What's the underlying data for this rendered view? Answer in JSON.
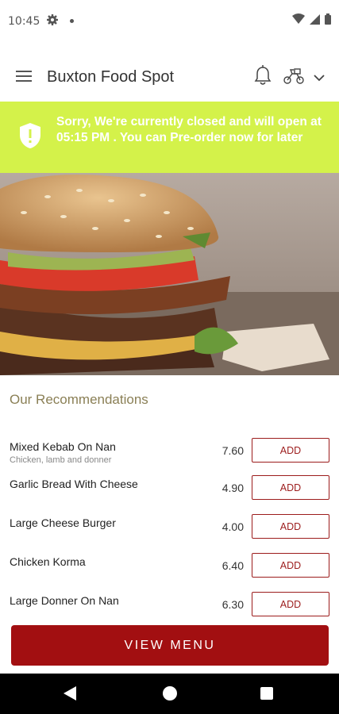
{
  "status_bar": {
    "time": "10:45"
  },
  "app_bar": {
    "title": "Buxton Food Spot"
  },
  "banner": {
    "message": "Sorry, We're currently closed and will open at 05:15 PM . You can Pre-order now for later"
  },
  "recommendations": {
    "heading": "Our Recommendations",
    "items": [
      {
        "name": "Mixed Kebab On Nan",
        "description": "Chicken, lamb and donner",
        "price": "7.60",
        "add_label": "ADD"
      },
      {
        "name": "Garlic Bread With Cheese",
        "description": "",
        "price": "4.90",
        "add_label": "ADD"
      },
      {
        "name": "Large Cheese Burger",
        "description": "",
        "price": "4.00",
        "add_label": "ADD"
      },
      {
        "name": "Chicken Korma",
        "description": "",
        "price": "6.40",
        "add_label": "ADD"
      },
      {
        "name": "Large Donner On Nan",
        "description": "",
        "price": "6.30",
        "add_label": "ADD"
      }
    ]
  },
  "view_menu_label": "VIEW MENU",
  "colors": {
    "banner": "#d4f24a",
    "accent": "#a20f11",
    "heading": "#8a7f55"
  }
}
